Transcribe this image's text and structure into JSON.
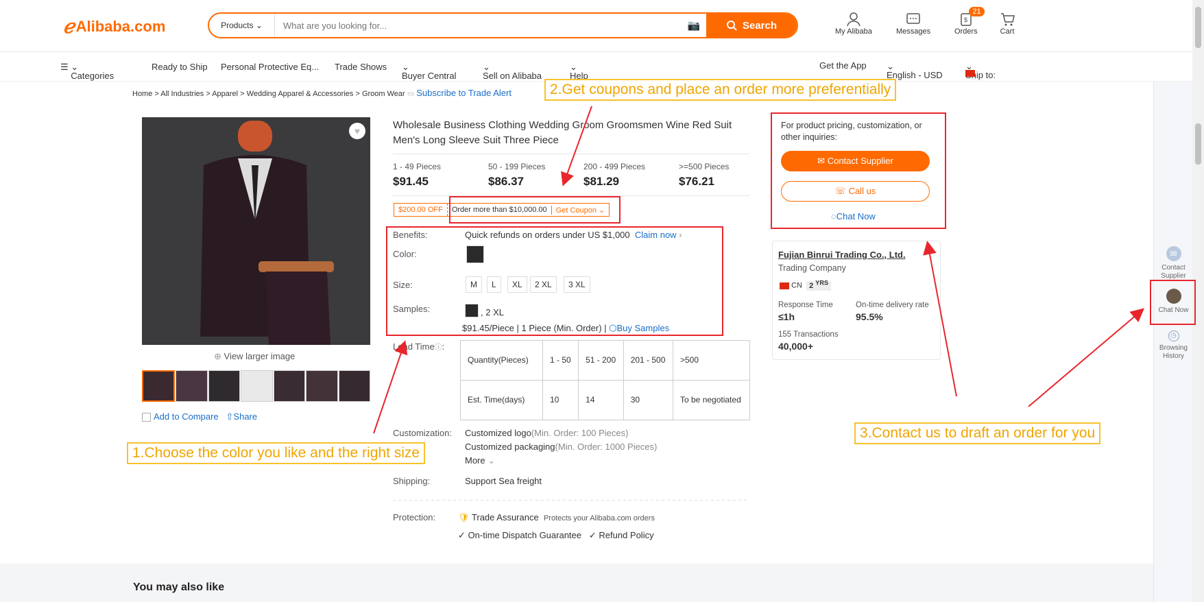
{
  "header": {
    "logo": "Alibaba.com",
    "search_category": "Products",
    "search_placeholder": "What are you looking for...",
    "search_button": "Search",
    "my_alibaba": "My Alibaba",
    "messages": "Messages",
    "orders": "Orders",
    "orders_badge": "21",
    "cart": "Cart"
  },
  "nav": {
    "categories": "Categories",
    "ready_to_ship": "Ready to Ship",
    "ppe": "Personal Protective Eq...",
    "trade_shows": "Trade Shows",
    "buyer_central": "Buyer Central",
    "sell_on_alibaba": "Sell on Alibaba",
    "help": "Help",
    "get_app": "Get the App",
    "language": "English - USD",
    "ship_to": "Ship to:"
  },
  "breadcrumb": {
    "items": [
      "Home",
      "All Industries",
      "Apparel",
      "Wedding Apparel & Accessories",
      "Groom Wear"
    ],
    "subscribe": "Subscribe to Trade Alert"
  },
  "gallery": {
    "view_larger": "View larger image",
    "add_to_compare": "Add to Compare",
    "share": "Share"
  },
  "product": {
    "title": "Wholesale Business Clothing Wedding Groom Groomsmen Wine Red Suit Men's Long Sleeve Suit Three Piece",
    "tiers": [
      {
        "range": "1 - 49 Pieces",
        "price": "$91.45"
      },
      {
        "range": "50 - 199 Pieces",
        "price": "$86.37"
      },
      {
        "range": "200 - 499 Pieces",
        "price": "$81.29"
      },
      {
        "range": ">=500 Pieces",
        "price": "$76.21"
      }
    ],
    "coupon": {
      "off": "$200.00 OFF",
      "condition": "Order more than $10,000.00",
      "get": "Get Coupon"
    },
    "benefits_label": "Benefits:",
    "benefits_text": "Quick refunds on orders under US $1,000",
    "claim_now": "Claim now",
    "color_label": "Color:",
    "size_label": "Size:",
    "sizes": [
      "M",
      "L",
      "XL",
      "2 XL",
      "3 XL"
    ],
    "samples_label": "Samples:",
    "samples_size": ", 2 XL",
    "samples_price": "$91.45/Piece | 1 Piece (Min. Order) |",
    "buy_samples": "Buy Samples",
    "lead_time_label": "Lead Time",
    "lead_rows": [
      [
        "Quantity(Pieces)",
        "1 - 50",
        "51 - 200",
        "201 - 500",
        ">500"
      ],
      [
        "Est. Time(days)",
        "10",
        "14",
        "30",
        "To be negotiated"
      ]
    ],
    "customization_label": "Customization:",
    "custom_logo": "Customized logo",
    "custom_logo_min": "(Min. Order: 100 Pieces)",
    "custom_pack": "Customized packaging",
    "custom_pack_min": "(Min. Order: 1000 Pieces)",
    "more": "More",
    "shipping_label": "Shipping:",
    "shipping_value": "Support Sea freight",
    "protection_label": "Protection:",
    "trade_assurance": "Trade Assurance",
    "trade_assurance_desc": "Protects your Alibaba.com orders",
    "dispatch": "On-time Dispatch Guarantee",
    "refund": "Refund Policy"
  },
  "contact": {
    "inquiry_text": "For product pricing, customization, or other inquiries:",
    "contact_supplier": "Contact Supplier",
    "call_us": "Call us",
    "chat_now": "Chat Now"
  },
  "supplier": {
    "name": "Fujian Binrui Trading Co., Ltd.",
    "type": "Trading Company",
    "country": "CN",
    "years": "2",
    "years_unit": "YRS",
    "response_label": "Response Time",
    "response_value": "≤1h",
    "delivery_label": "On-time delivery rate",
    "delivery_value": "95.5%",
    "transactions_label": "155 Transactions",
    "transactions_value": "40,000+"
  },
  "sidebar": {
    "contact_supplier": "Contact Supplier",
    "chat_now": "Chat Now",
    "browsing_history": "Browsing History"
  },
  "annotations": {
    "step1": "1.Choose the color you like and the right size",
    "step2": "2.Get coupons and place an order more preferentially",
    "step3": "3.Contact us to draft an order for you"
  },
  "recommend": {
    "title": "You may also like"
  },
  "colors": {
    "accent": "#ff6a00",
    "link": "#1a6fc9",
    "annotation_red": "#e8262b",
    "annotation_yellow": "#f7c22b"
  }
}
